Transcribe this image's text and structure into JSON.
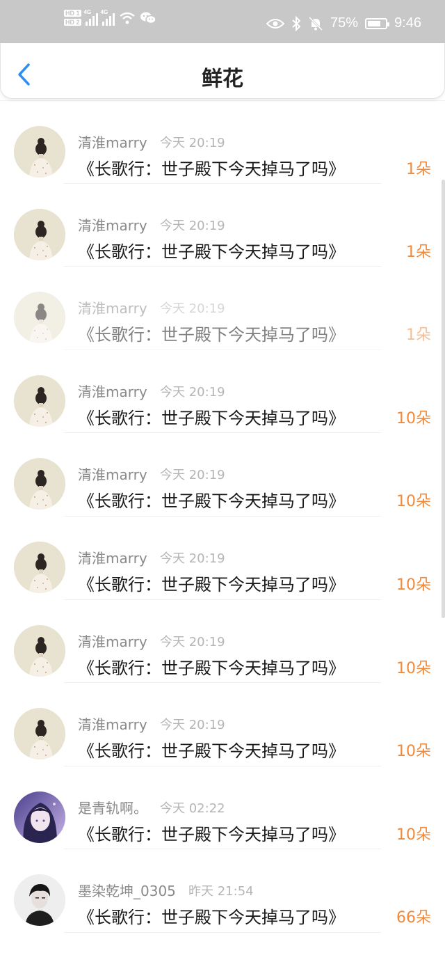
{
  "status_bar": {
    "hd1": "HD 1",
    "hd2": "HD 2",
    "sig1_label": "4G",
    "sig2_label": "4G",
    "battery_percent": "75%",
    "battery_level": 0.75,
    "time": "9:46"
  },
  "header": {
    "title": "鲜花",
    "back_icon": "chevron-left-icon"
  },
  "colors": {
    "accent_blue": "#2f8ff0",
    "count_orange": "#f08a3c"
  },
  "items": [
    {
      "user": "清淮marry",
      "time": "今天 20:19",
      "book": "《长歌行：世子殿下今天掉马了吗》",
      "count": "1朵",
      "avatar": "illustrated-woman",
      "faded": false
    },
    {
      "user": "清淮marry",
      "time": "今天 20:19",
      "book": "《长歌行：世子殿下今天掉马了吗》",
      "count": "1朵",
      "avatar": "illustrated-woman",
      "faded": false
    },
    {
      "user": "清淮marry",
      "time": "今天 20:19",
      "book": "《长歌行：世子殿下今天掉马了吗》",
      "count": "1朵",
      "avatar": "illustrated-woman",
      "faded": true
    },
    {
      "user": "清淮marry",
      "time": "今天 20:19",
      "book": "《长歌行：世子殿下今天掉马了吗》",
      "count": "10朵",
      "avatar": "illustrated-woman",
      "faded": false
    },
    {
      "user": "清淮marry",
      "time": "今天 20:19",
      "book": "《长歌行：世子殿下今天掉马了吗》",
      "count": "10朵",
      "avatar": "illustrated-woman",
      "faded": false
    },
    {
      "user": "清淮marry",
      "time": "今天 20:19",
      "book": "《长歌行：世子殿下今天掉马了吗》",
      "count": "10朵",
      "avatar": "illustrated-woman",
      "faded": false
    },
    {
      "user": "清淮marry",
      "time": "今天 20:19",
      "book": "《长歌行：世子殿下今天掉马了吗》",
      "count": "10朵",
      "avatar": "illustrated-woman",
      "faded": false
    },
    {
      "user": "清淮marry",
      "time": "今天 20:19",
      "book": "《长歌行：世子殿下今天掉马了吗》",
      "count": "10朵",
      "avatar": "illustrated-woman",
      "faded": false
    },
    {
      "user": "是青轨啊。",
      "time": "今天 02:22",
      "book": "《长歌行：世子殿下今天掉马了吗》",
      "count": "10朵",
      "avatar": "anime-girl-purple",
      "faded": false
    },
    {
      "user": "墨染乾坤_0305",
      "time": "昨天 21:54",
      "book": "《长歌行：世子殿下今天掉马了吗》",
      "count": "66朵",
      "avatar": "mono-portrait",
      "faded": false
    }
  ]
}
